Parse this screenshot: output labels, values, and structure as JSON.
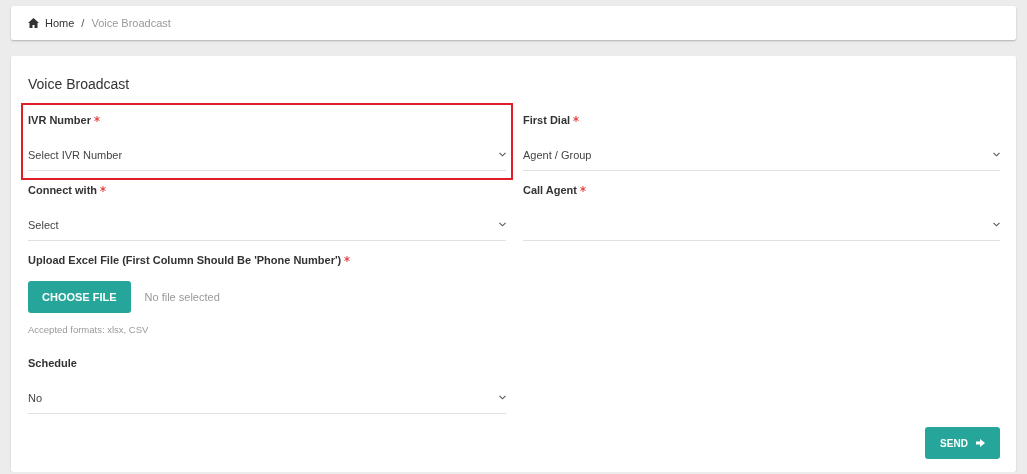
{
  "breadcrumb": {
    "separator": "/",
    "items": [
      {
        "label": "Home",
        "kind": "home",
        "current": false
      },
      {
        "label": "Voice Broadcast",
        "current": true
      }
    ]
  },
  "form": {
    "title": "Voice Broadcast",
    "fields": [
      {
        "kind": "select",
        "label": "IVR Number",
        "required": true,
        "value": "Select IVR Number",
        "highlighted": true
      },
      {
        "kind": "select",
        "label": "First Dial",
        "required": true,
        "value": "Agent / Group",
        "highlighted": false
      },
      {
        "kind": "select",
        "label": "Connect with",
        "required": true,
        "value": "Select",
        "highlighted": false
      },
      {
        "kind": "select",
        "label": "Call Agent",
        "required": true,
        "highlighted": false
      },
      {
        "kind": "file",
        "label": "Upload Excel File (First Column Should Be 'Phone Number')",
        "required": true,
        "button": "CHOOSE FILE",
        "status": "No file selected",
        "help": "Accepted formats: xlsx, CSV",
        "highlighted": false
      },
      {
        "kind": "select",
        "label": "Schedule",
        "required": false,
        "value": "No",
        "highlighted": false
      }
    ],
    "submit": "SEND"
  }
}
